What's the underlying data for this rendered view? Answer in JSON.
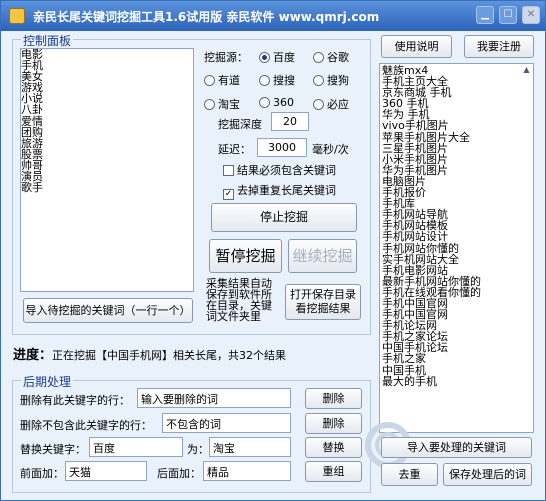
{
  "window": {
    "title": "亲民长尾关键词挖掘工具1.6试用版   亲民软件 www.qmrj.com",
    "controls": {
      "minimize": "▁",
      "maximize": "☐",
      "close": "✕"
    }
  },
  "control_panel": {
    "title": "控制面板",
    "keywords": [
      "电影",
      "手机",
      "美女",
      "游戏",
      "小说",
      "八卦",
      "爱情",
      "团购",
      "旅游",
      "股票",
      "帅哥",
      "演员",
      "歌手"
    ],
    "import_button": "导入待挖掘的关键词（一行一个）"
  },
  "settings": {
    "source_label": "挖掘源：",
    "sources": [
      {
        "label": "百度",
        "selected": true
      },
      {
        "label": "谷歌",
        "selected": false
      },
      {
        "label": "有道",
        "selected": false
      },
      {
        "label": "搜搜",
        "selected": false
      },
      {
        "label": "搜狗",
        "selected": false
      },
      {
        "label": "淘宝",
        "selected": false
      },
      {
        "label": "360",
        "selected": false
      },
      {
        "label": "必应",
        "selected": false
      }
    ],
    "depth_label": "挖掘深度",
    "depth_value": "20",
    "delay_label": "延迟：",
    "delay_value": "3000",
    "delay_unit": "毫秒/次",
    "check_must_contain": {
      "label": "结果必须包含关键词",
      "checked": false
    },
    "check_dedupe": {
      "label": "去掉重复长尾关键词",
      "checked": true,
      "mark": "✓"
    },
    "stop_button": "停止挖掘",
    "pause_button": "暂停挖掘",
    "resume_button": "继续挖掘",
    "auto_save_note": "采集结果自动保存到软件所在目录，关键词文件夹里",
    "open_dir_button_line1": "打开保存目录",
    "open_dir_button_line2": "看挖掘结果"
  },
  "top_buttons": {
    "help": "使用说明",
    "register": "我要注册"
  },
  "results": [
    "魅族mx4",
    "手机主页大全",
    "京东商城 手机",
    "360 手机",
    "华为 手机",
    "vivo手机图片",
    "苹果手机图片大全",
    "三星手机图片",
    "小米手机图片",
    "华为手机图片",
    "电脑图片",
    "手机报价",
    "手机库",
    "手机网站导航",
    "手机网站模板",
    "手机网站设计",
    "手机网站你懂的",
    "实手机网站大全",
    "手机电影网站",
    "最新手机网站你懂的",
    "手机在线观看你懂的",
    "手机中国官网",
    "手机中国官网",
    "手机论坛网",
    "手机之家论坛",
    "中国手机论坛",
    "手机之家",
    "中国手机",
    "最大的手机"
  ],
  "progress": {
    "label": "进度：",
    "text": "正在挖掘【中国手机网】相关长尾，共32个结果"
  },
  "post_processing": {
    "title": "后期处理",
    "delete_contains_label": "删除有此关键字的行：",
    "delete_contains_input": "输入要删除的词",
    "delete_contains_button": "删除",
    "delete_not_contains_label": "删除不包含此关键字的行：",
    "delete_not_contains_input": "不包含的词",
    "delete_not_contains_button": "删除",
    "replace_label": "替换关键字：",
    "replace_from": "百度",
    "replace_to_label": "为：",
    "replace_to": "淘宝",
    "replace_button": "替换",
    "prefix_label": "前面加：",
    "prefix_value": "天猫",
    "suffix_label": "后面加：",
    "suffix_value": "精品",
    "regroup_button": "重组",
    "import_processing_button": "导入要处理的关键词",
    "dedupe_button": "去重",
    "save_button": "保存处理后的词"
  }
}
